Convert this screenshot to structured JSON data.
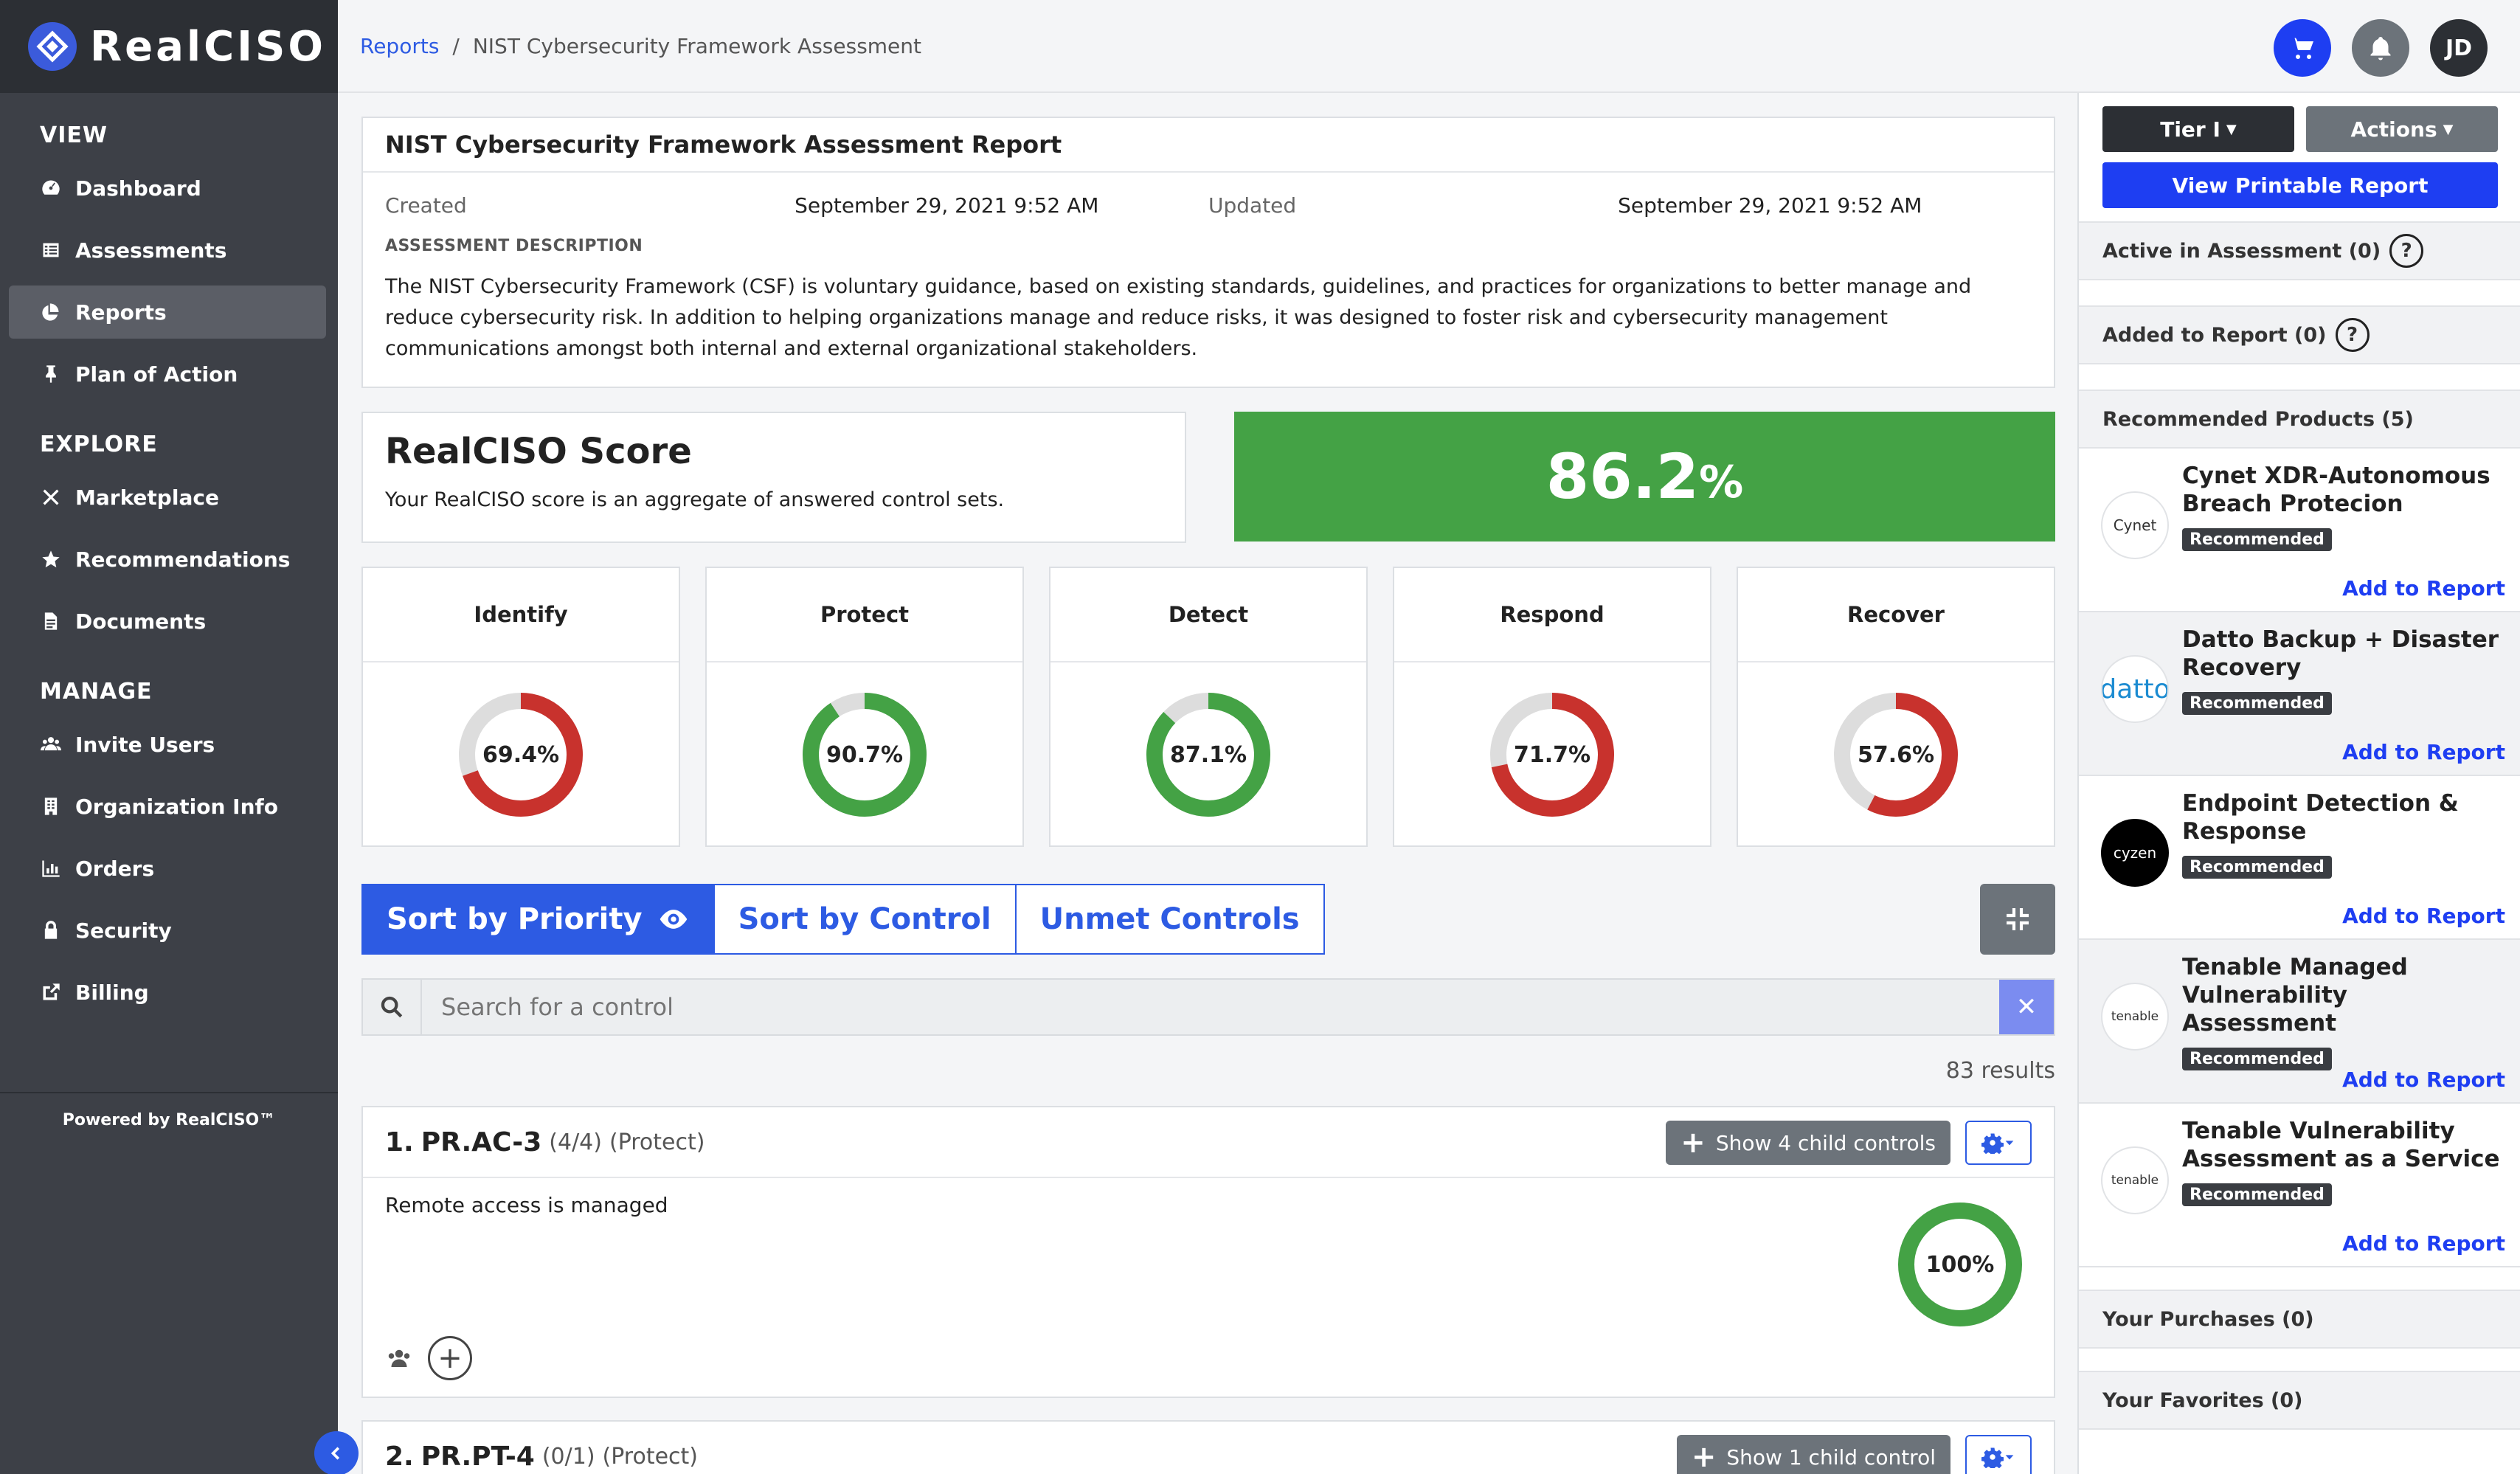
{
  "app": {
    "name": "RealCISO",
    "powered": "Powered by RealCISO™"
  },
  "nav": {
    "sections": [
      {
        "title": "VIEW",
        "items": [
          "Dashboard",
          "Assessments",
          "Reports",
          "Plan of Action"
        ]
      },
      {
        "title": "EXPLORE",
        "items": [
          "Marketplace",
          "Recommendations",
          "Documents"
        ]
      },
      {
        "title": "MANAGE",
        "items": [
          "Invite Users",
          "Organization Info",
          "Orders",
          "Security",
          "Billing"
        ]
      }
    ],
    "active": "Reports"
  },
  "breadcrumb": {
    "parent": "Reports",
    "sep": "/",
    "current": "NIST Cybersecurity Framework Assessment"
  },
  "user": {
    "initials": "JD"
  },
  "report": {
    "title": "NIST Cybersecurity Framework Assessment Report",
    "created_label": "Created",
    "created": "September 29, 2021 9:52 AM",
    "updated_label": "Updated",
    "updated": "September 29, 2021 9:52 AM",
    "desc_label": "ASSESSMENT DESCRIPTION",
    "desc": "The NIST Cybersecurity Framework (CSF) is voluntary guidance, based on existing standards, guidelines, and practices for organizations to better manage and reduce cybersecurity risk. In addition to helping organizations manage and reduce risks, it was designed to foster risk and cybersecurity management communications amongst both internal and external organizational stakeholders."
  },
  "score": {
    "title": "RealCISO Score",
    "subtitle": "Your RealCISO score is an aggregate of answered control sets.",
    "value": "86.2",
    "unit": "%"
  },
  "functions": [
    {
      "name": "Identify",
      "value": 69.4,
      "label": "69.4%",
      "color": "#c8322d"
    },
    {
      "name": "Protect",
      "value": 90.7,
      "label": "90.7%",
      "color": "#44a245"
    },
    {
      "name": "Detect",
      "value": 87.1,
      "label": "87.1%",
      "color": "#44a245"
    },
    {
      "name": "Respond",
      "value": 71.7,
      "label": "71.7%",
      "color": "#c8322d"
    },
    {
      "name": "Recover",
      "value": 57.6,
      "label": "57.6%",
      "color": "#c8322d"
    }
  ],
  "sort": {
    "priority": "Sort by Priority",
    "control": "Sort by Control",
    "unmet": "Unmet Controls"
  },
  "search": {
    "placeholder": "Search for a control",
    "clear": "✕"
  },
  "results": "83 results",
  "controls": [
    {
      "num": "1.",
      "id": "PR.AC-3",
      "count": "(4/4)",
      "fn": "(Protect)",
      "child": "Show 4 child controls",
      "desc": "Remote access is managed",
      "value": 100,
      "label": "100%"
    },
    {
      "num": "2.",
      "id": "PR.PT-4",
      "count": "(0/1)",
      "fn": "(Protect)",
      "child": "Show 1 child control"
    }
  ],
  "rpanel": {
    "tier": "Tier I",
    "actions": "Actions",
    "print": "View Printable Report",
    "active": "Active in Assessment (0)",
    "added": "Added to Report (0)",
    "recommended": "Recommended Products (5)",
    "products": [
      {
        "name": "Cynet XDR-Autonomous Breach Protecion",
        "logo": "Cynet",
        "badge": "Recommended",
        "add": "Add to Report"
      },
      {
        "name": "Datto Backup + Disaster Recovery",
        "logo": "datto",
        "badge": "Recommended",
        "add": "Add to Report"
      },
      {
        "name": "Endpoint Detection & Response",
        "logo": "cyzen",
        "badge": "Recommended",
        "add": "Add to Report"
      },
      {
        "name": "Tenable Managed Vulnerability Assessment",
        "logo": "tenable",
        "badge": "Recommended",
        "add": "Add to Report"
      },
      {
        "name": "Tenable Vulnerability Assessment as a Service",
        "logo": "tenable",
        "badge": "Recommended",
        "add": "Add to Report"
      }
    ],
    "purchases": "Your Purchases (0)",
    "favorites": "Your Favorites (0)"
  }
}
